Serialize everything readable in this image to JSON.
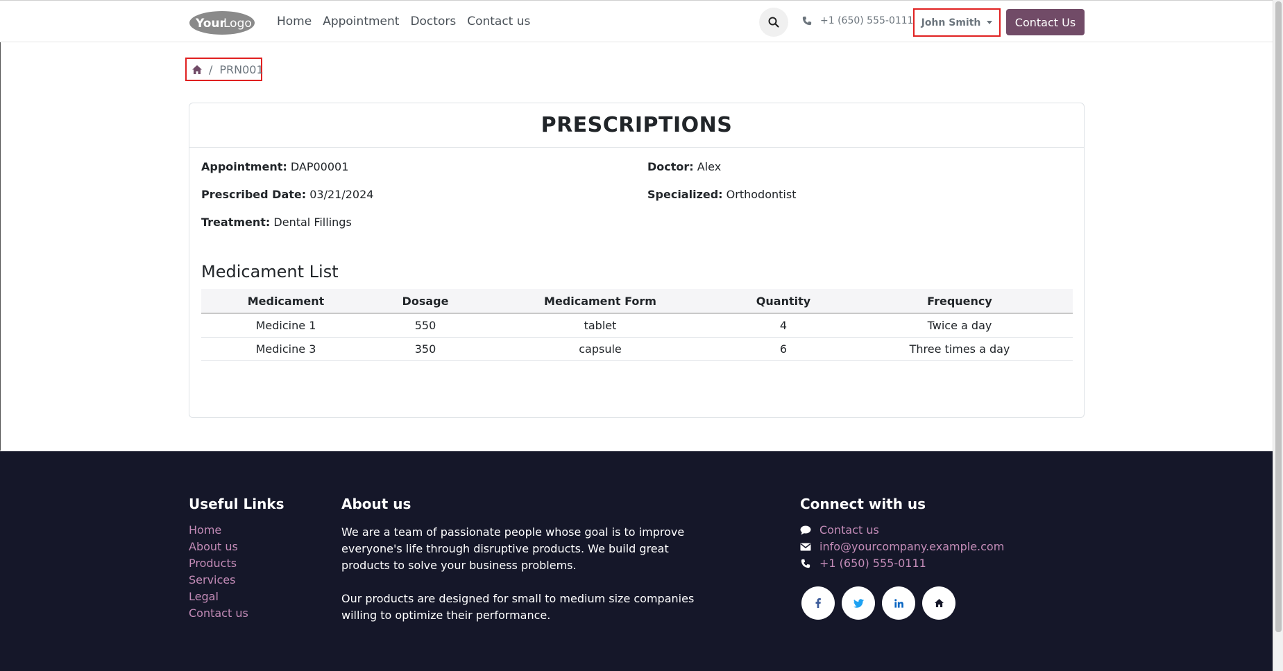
{
  "header": {
    "nav": [
      "Home",
      "Appointment",
      "Doctors",
      "Contact us"
    ],
    "phone": "+1 (650) 555-0111",
    "user_name": "John Smith",
    "contact_button": "Contact Us"
  },
  "breadcrumb": {
    "current": "PRN001"
  },
  "prescription": {
    "title": "PRESCRIPTIONS",
    "fields": {
      "appointment_label": "Appointment:",
      "appointment_value": "DAP00001",
      "prescribed_date_label": "Prescribed Date:",
      "prescribed_date_value": "03/21/2024",
      "treatment_label": "Treatment:",
      "treatment_value": "Dental Fillings",
      "doctor_label": "Doctor:",
      "doctor_value": "Alex",
      "specialized_label": "Specialized:",
      "specialized_value": "Orthodontist"
    },
    "medicament_list_title": "Medicament List",
    "table": {
      "headers": [
        "Medicament",
        "Dosage",
        "Medicament Form",
        "Quantity",
        "Frequency"
      ],
      "rows": [
        [
          "Medicine 1",
          "550",
          "tablet",
          "4",
          "Twice a day"
        ],
        [
          "Medicine 3",
          "350",
          "capsule",
          "6",
          "Three times a day"
        ]
      ]
    }
  },
  "footer": {
    "useful_links_title": "Useful Links",
    "useful_links": [
      "Home",
      "About us",
      "Products",
      "Services",
      "Legal",
      "Contact us"
    ],
    "about_title": "About us",
    "about_p1": "We are a team of passionate people whose goal is to improve everyone's life through disruptive products. We build great products to solve your business problems.",
    "about_p2": "Our products are designed for small to medium size companies willing to optimize their performance.",
    "connect_title": "Connect with us",
    "connect_contact": "Contact us",
    "connect_email": "info@yourcompany.example.com",
    "connect_phone": "+1 (650) 555-0111",
    "socials": [
      "facebook-icon",
      "twitter-icon",
      "linkedin-icon",
      "home-icon"
    ]
  },
  "colors": {
    "brand": "#714b67",
    "footer_bg": "#151729",
    "link": "#c48cb8",
    "highlight": "#e02020"
  }
}
